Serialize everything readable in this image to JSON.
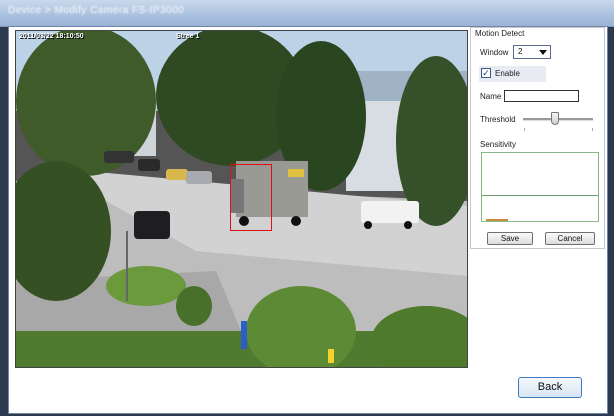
{
  "window": {
    "title": "Device > Modify Camera FS-IP3000"
  },
  "video": {
    "timestamp": "2011/03/22 18:10:50",
    "camera_label": "Stree 1"
  },
  "motion_detect": {
    "panel_title": "Motion Detect",
    "window_label": "Window",
    "window_value": "2",
    "enable_label": "Enable",
    "enable_checked": "✓",
    "name_label": "Name",
    "name_value": "",
    "threshold_label": "Threshold",
    "threshold_level": 0.45,
    "sensitivity_label": "Sensitivity",
    "save_label": "Save",
    "cancel_label": "Cancel"
  },
  "footer": {
    "back_label": "Back"
  },
  "colors": {
    "motion_box": "#e01010",
    "accent": "#3d7bbf"
  }
}
